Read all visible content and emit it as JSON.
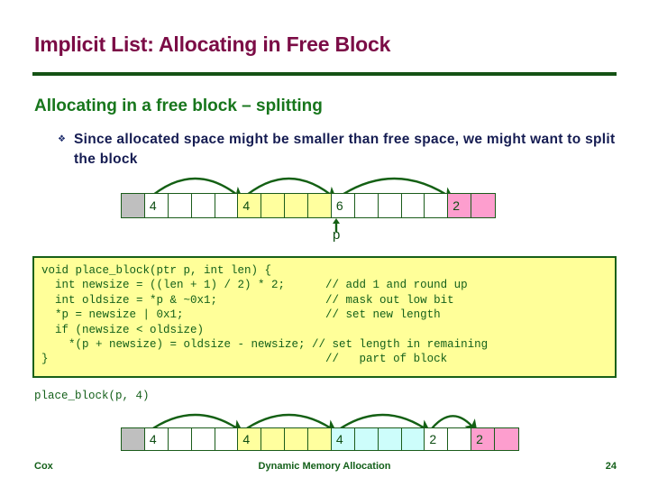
{
  "slide": {
    "title": "Implicit List: Allocating in Free Block",
    "subhead": "Allocating in a free block – splitting",
    "bullet": {
      "marker": "❖",
      "text": "Since allocated space might be smaller than free space, we might want to split the block"
    },
    "call_label": "place_block(p, 4)",
    "code": "void place_block(ptr p, int len) {\n  int newsize = ((len + 1) / 2) * 2;      // add 1 and round up\n  int oldsize = *p & ~0x1;                // mask out low bit\n  *p = newsize | 0x1;                     // set new length\n  if (newsize < oldsize)\n    *(p + newsize) = oldsize - newsize; // set length in remaining\n}                                         //   part of block",
    "pointer_label": "p"
  },
  "diagram_before": {
    "name": "memory-blocks-before",
    "cells": [
      {
        "fill": "gray",
        "label": ""
      },
      {
        "fill": "white",
        "label": "4"
      },
      {
        "fill": "white",
        "label": ""
      },
      {
        "fill": "white",
        "label": ""
      },
      {
        "fill": "white",
        "label": ""
      },
      {
        "fill": "yellow",
        "label": "4"
      },
      {
        "fill": "yellow",
        "label": ""
      },
      {
        "fill": "yellow",
        "label": ""
      },
      {
        "fill": "yellow",
        "label": ""
      },
      {
        "fill": "white",
        "label": "6"
      },
      {
        "fill": "white",
        "label": ""
      },
      {
        "fill": "white",
        "label": ""
      },
      {
        "fill": "white",
        "label": ""
      },
      {
        "fill": "white",
        "label": ""
      },
      {
        "fill": "pink",
        "label": "2"
      },
      {
        "fill": "pink",
        "label": ""
      }
    ],
    "arcs": [
      {
        "from": 1,
        "to": 5
      },
      {
        "from": 5,
        "to": 9
      },
      {
        "from": 9,
        "to": 14
      }
    ],
    "pointer_cell": 9
  },
  "diagram_after": {
    "name": "memory-blocks-after",
    "cells": [
      {
        "fill": "gray",
        "label": ""
      },
      {
        "fill": "white",
        "label": "4"
      },
      {
        "fill": "white",
        "label": ""
      },
      {
        "fill": "white",
        "label": ""
      },
      {
        "fill": "white",
        "label": ""
      },
      {
        "fill": "yellow",
        "label": "4"
      },
      {
        "fill": "yellow",
        "label": ""
      },
      {
        "fill": "yellow",
        "label": ""
      },
      {
        "fill": "yellow",
        "label": ""
      },
      {
        "fill": "cyan",
        "label": "4"
      },
      {
        "fill": "cyan",
        "label": ""
      },
      {
        "fill": "cyan",
        "label": ""
      },
      {
        "fill": "cyan",
        "label": ""
      },
      {
        "fill": "white",
        "label": "2"
      },
      {
        "fill": "white",
        "label": ""
      },
      {
        "fill": "pink",
        "label": "2"
      },
      {
        "fill": "pink",
        "label": ""
      }
    ],
    "arcs": [
      {
        "from": 1,
        "to": 5
      },
      {
        "from": 5,
        "to": 9
      },
      {
        "from": 9,
        "to": 13
      },
      {
        "from": 13,
        "to": 15
      }
    ]
  },
  "footer": {
    "left": "Cox",
    "center": "Dynamic Memory Allocation",
    "right": "24"
  },
  "colors": {
    "title": "#7b0c46",
    "rule": "#145214",
    "subhead": "#17761c",
    "bullet_text": "#151c52",
    "code_text": "#14601a",
    "code_bg": "#ffff99",
    "code_border": "#186018",
    "arrow": "#146014",
    "cell_border": "#1a5c1a",
    "fill_gray": "#bfbfbf",
    "fill_yellow": "#ffff9e",
    "fill_cyan": "#cdfdfb",
    "fill_pink": "#fd9ece"
  }
}
